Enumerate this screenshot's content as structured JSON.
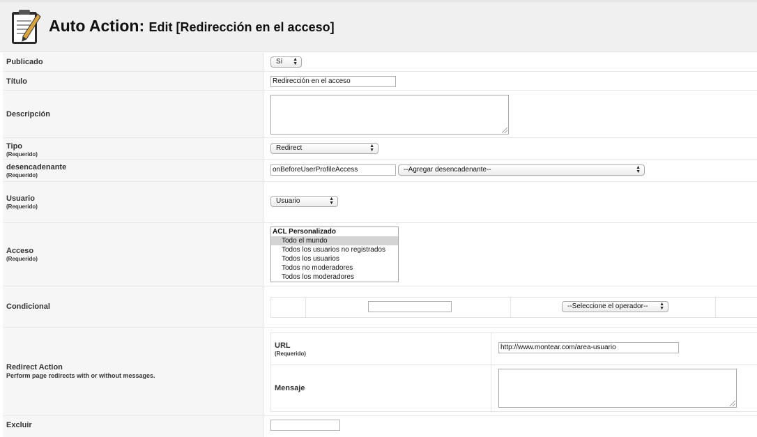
{
  "header": {
    "title": "Auto Action:",
    "subtitle": "Edit [Redirección en el acceso]",
    "icon": "notepad-edit-icon"
  },
  "form": {
    "publicado": {
      "label": "Publicado",
      "value": "Sí"
    },
    "titulo": {
      "label": "Título",
      "value": "Redirección en el acceso"
    },
    "descripcion": {
      "label": "Descripción",
      "value": ""
    },
    "tipo": {
      "label": "Tipo",
      "required": "(Requerido)",
      "value": "Redirect"
    },
    "trigger": {
      "label": "desencadenante",
      "required": "(Requerido)",
      "value": "onBeforeUserProfileAccess",
      "add_select": "--Agregar desencadenante--"
    },
    "usuario": {
      "label": "Usuario",
      "required": "(Requerido)",
      "value": "Usuario"
    },
    "acceso": {
      "label": "Acceso",
      "required": "(Requerido)",
      "group": "ACL Personalizado",
      "options": [
        "Todo el mundo",
        "Todos los usuarios no registrados",
        "Todos los usuarios",
        "Todos no moderadores",
        "Todos los moderadores"
      ],
      "selected_index": 0
    },
    "condicional": {
      "label": "Condicional",
      "field_value": "",
      "operator": "--Seleccione el operador--"
    },
    "redirect": {
      "label": "Redirect Action",
      "description": "Perform page redirects with or without messages.",
      "url_label": "URL",
      "url_required": "(Requerido)",
      "url_value": "http://www.montear.com/area-usuario",
      "mensaje_label": "Mensaje",
      "mensaje_value": ""
    },
    "excluir": {
      "label": "Excluir"
    }
  }
}
